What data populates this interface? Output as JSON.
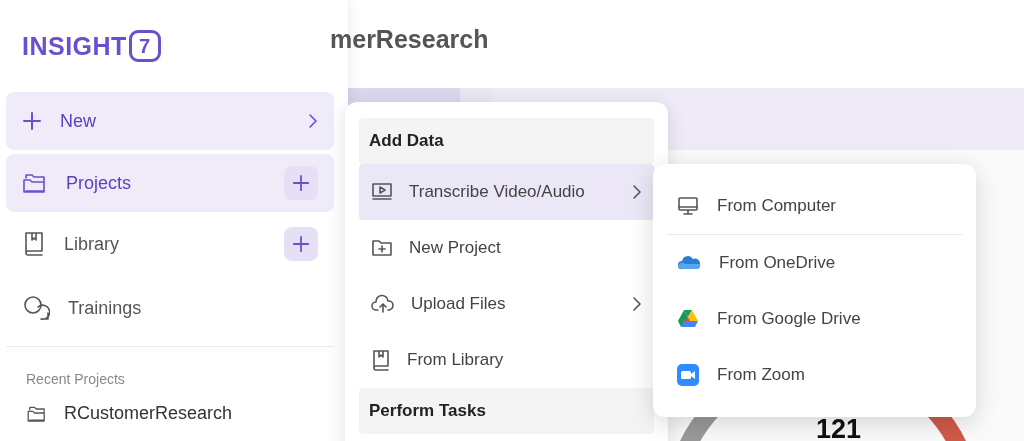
{
  "logo": {
    "text": "INSIGHT",
    "mark": "7"
  },
  "page_title": "merResearch",
  "sidebar": {
    "items": [
      {
        "label": "New",
        "kind": "expand",
        "highlighted": true
      },
      {
        "label": "Projects",
        "kind": "add",
        "highlighted": true
      },
      {
        "label": "Library",
        "kind": "add",
        "highlighted": false
      },
      {
        "label": "Trainings",
        "kind": "plain",
        "highlighted": false
      }
    ],
    "recent_heading": "Recent Projects",
    "recent_projects": [
      "RCustomerResearch"
    ]
  },
  "menu": {
    "sections": [
      {
        "heading": "Add Data",
        "items": [
          {
            "label": "Transcribe Video/Audio",
            "submenu": true,
            "selected": true
          },
          {
            "label": "New Project",
            "submenu": false,
            "selected": false
          },
          {
            "label": "Upload Files",
            "submenu": true,
            "selected": false
          },
          {
            "label": "From Library",
            "submenu": false,
            "selected": false
          }
        ]
      },
      {
        "heading": "Perform Tasks"
      }
    ]
  },
  "submenu": {
    "items": [
      "From Computer",
      "From OneDrive",
      "From Google Drive",
      "From Zoom"
    ]
  },
  "gauge": {
    "value": "121"
  }
}
